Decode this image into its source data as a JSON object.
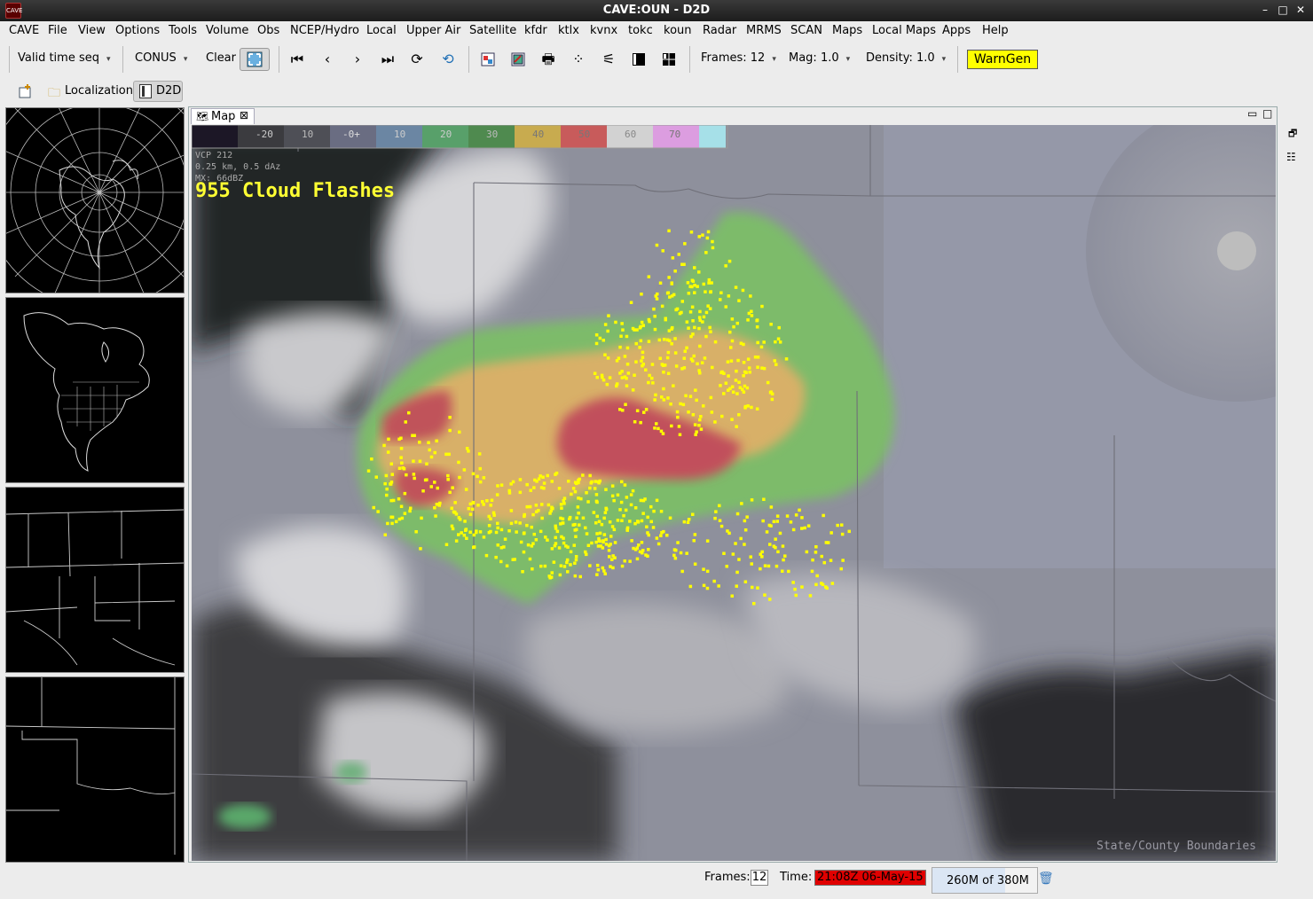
{
  "window": {
    "title": "CAVE:OUN - D2D",
    "app_icon": "CAVE",
    "minimize": "–",
    "maximize": "□",
    "close": "✕"
  },
  "menu": [
    "CAVE",
    "File",
    "View",
    "Options",
    "Tools",
    "Volume",
    "Obs",
    "NCEP/Hydro",
    "Local",
    "Upper Air",
    "Satellite",
    "kfdr",
    "ktlx",
    "kvnx",
    "tokc",
    "koun",
    "Radar",
    "MRMS",
    "SCAN",
    "Maps",
    "Local Maps",
    "Apps",
    "Help"
  ],
  "toolbar": {
    "valid_time": "Valid time seq",
    "scale": "CONUS",
    "clear": "Clear",
    "frames": "Frames: 12",
    "mag": "Mag: 1.0",
    "density": "Density: 1.0",
    "warngen": "WarnGen"
  },
  "perspectives": {
    "localization": "Localization",
    "d2d": "D2D"
  },
  "map": {
    "tab_label": "Map",
    "colorbar_labels": [
      "-20",
      "10",
      "-0+",
      "10",
      "20",
      "30",
      "40",
      "50",
      "60",
      "70"
    ],
    "vcp": "VCP 212",
    "elev": "0.25 km, 0.5 dAz",
    "mx": "MX: 66dBZ",
    "flash_label": "955 Cloud Flashes",
    "boundaries_label": "State/County Boundaries"
  },
  "status": {
    "frames_label": "Frames:",
    "frames_value": "12",
    "time_label": "Time:",
    "time_value": "21:08Z 06-May-15",
    "memory": "260M of 380M"
  },
  "colors": {
    "warngen": "#ffff00",
    "time_bg": "#e00000",
    "flash_text": "#ffff33",
    "lightning": "#ffff00"
  }
}
